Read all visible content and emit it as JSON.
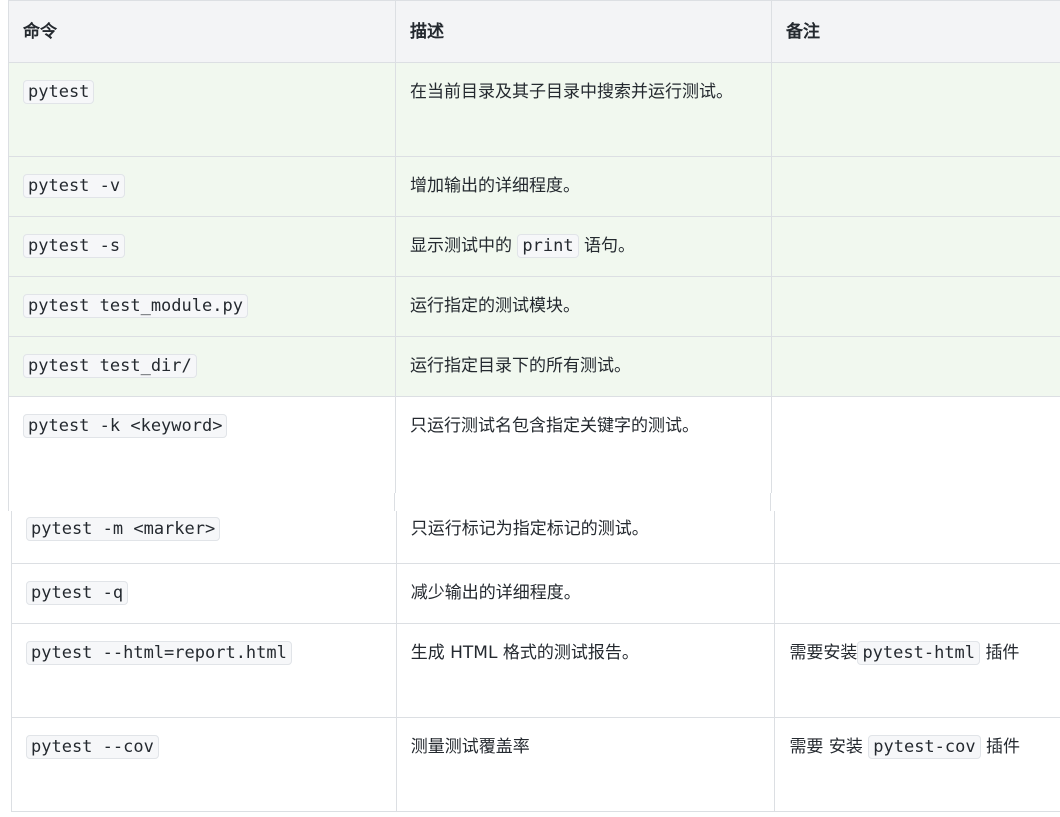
{
  "header": {
    "col1": "命令",
    "col2": "描述",
    "col3": "备注"
  },
  "rows": [
    {
      "cmd": "pytest",
      "desc": "在当前目录及其子目录中搜索并运行测试。",
      "note": ""
    },
    {
      "cmd": "pytest -v",
      "desc": "增加输出的详细程度。",
      "note": ""
    },
    {
      "cmd": "pytest -s",
      "desc_pre": "显示测试中的",
      "desc_code": "print",
      "desc_post": "语句。",
      "note": ""
    },
    {
      "cmd": "pytest test_module.py",
      "desc": "运行指定的测试模块。",
      "note": ""
    },
    {
      "cmd": "pytest test_dir/",
      "desc": "运行指定目录下的所有测试。",
      "note": ""
    },
    {
      "cmd": "pytest -k <keyword>",
      "desc": "只运行测试名包含指定关键字的测试。",
      "note": ""
    },
    {
      "cmd": "pytest -m <marker>",
      "desc": "只运行标记为指定标记的测试。",
      "note": ""
    },
    {
      "cmd": "pytest -q",
      "desc": "减少输出的详细程度。",
      "note": ""
    },
    {
      "cmd": "pytest --html=report.html",
      "desc": "生成 HTML 格式的测试报告。",
      "note_pre": "需要安装",
      "note_code": "pytest-html",
      "note_post": "插件"
    },
    {
      "cmd": "pytest --cov",
      "desc": "测量测试覆盖率",
      "note_pre": "需要 安装",
      "note_code": "pytest-cov",
      "note_post": "插件"
    }
  ]
}
